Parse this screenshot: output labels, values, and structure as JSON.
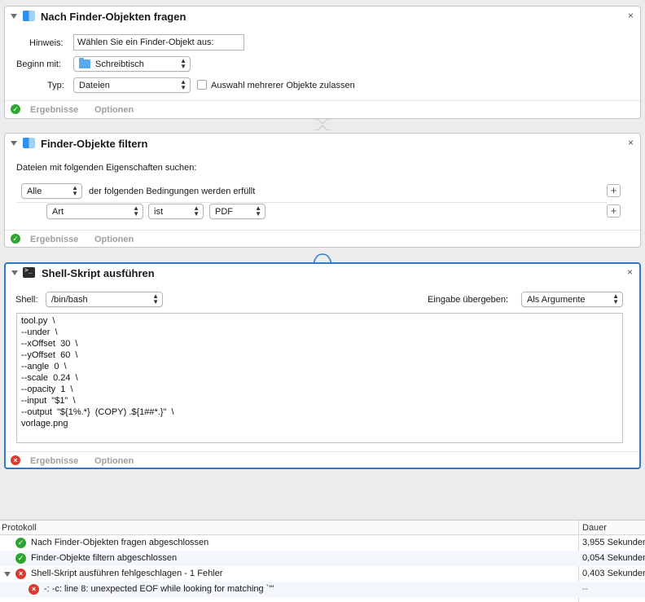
{
  "actions": [
    {
      "title": "Nach Finder-Objekten fragen",
      "hint_label": "Hinweis:",
      "hint_value": "Wählen Sie ein Finder-Objekt aus:",
      "start_label": "Beginn mit:",
      "start_value": "Schreibtisch",
      "type_label": "Typ:",
      "type_value": "Dateien",
      "multi_select_label": "Auswahl mehrerer Objekte zulassen",
      "multi_select_checked": false,
      "results_label": "Ergebnisse",
      "options_label": "Optionen",
      "status": "ok"
    },
    {
      "title": "Finder-Objekte filtern",
      "search_label": "Dateien mit folgenden Eigenschaften suchen:",
      "match_value": "Alle",
      "match_suffix": "der folgenden Bedingungen werden erfüllt",
      "condition": {
        "field": "Art",
        "operator": "ist",
        "value": "PDF"
      },
      "add_symbol": "+",
      "results_label": "Ergebnisse",
      "options_label": "Optionen",
      "status": "ok"
    },
    {
      "title": "Shell-Skript ausführen",
      "shell_label": "Shell:",
      "shell_value": "/bin/bash",
      "input_label": "Eingabe übergeben:",
      "input_value": "Als Argumente",
      "script": "tool.py  \\\n--under  \\\n--xOffset  30  \\\n--yOffset  60  \\\n--angle  0  \\\n--scale  0.24  \\\n--opacity  1  \\\n--input  \"$1\"  \\\n--output  \"${1%.*}  (COPY) .${1##*.}\"  \\\nvorlage.png",
      "results_label": "Ergebnisse",
      "options_label": "Optionen",
      "status": "error"
    }
  ],
  "log": {
    "col_protocol": "Protokoll",
    "col_duration": "Dauer",
    "rows": [
      {
        "text": "Nach Finder-Objekten fragen abgeschlossen",
        "duration": "3,955 Sekunden",
        "status": "ok"
      },
      {
        "text": "Finder-Objekte filtern abgeschlossen",
        "duration": "0,054 Sekunden",
        "status": "ok"
      },
      {
        "text": "Shell-Skript ausführen fehlgeschlagen - 1 Fehler",
        "duration": "0,403 Sekunden",
        "status": "error"
      },
      {
        "text": "-: -c: line 8: unexpected EOF while looking for matching `\"'",
        "duration": "--",
        "status": "error"
      }
    ]
  },
  "icons": {
    "close": "×",
    "check": "✓",
    "error": "×",
    "popup_arrows": "▲▼"
  },
  "colors": {
    "selection": "#2f78cc",
    "ok": "#2ea52e",
    "error": "#d93a32"
  }
}
